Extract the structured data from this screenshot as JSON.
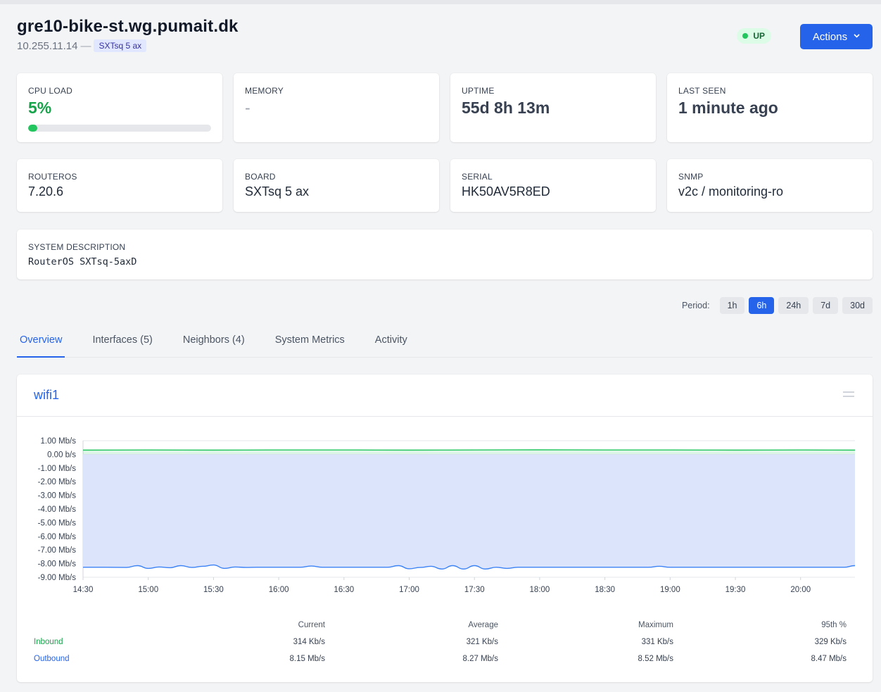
{
  "device": {
    "hostname": "gre10-bike-st.wg.pumait.dk",
    "ip": "10.255.11.14",
    "separator": "—",
    "model_badge": "SXTsq 5 ax",
    "status": "UP",
    "status_color": "#22c55e",
    "actions_label": "Actions"
  },
  "cards": {
    "cpu": {
      "label": "CPU LOAD",
      "value": "5%",
      "percent": 5
    },
    "memory": {
      "label": "MEMORY",
      "value": "-"
    },
    "uptime": {
      "label": "UPTIME",
      "value": "55d 8h 13m"
    },
    "last_seen": {
      "label": "LAST SEEN",
      "value": "1 minute ago"
    },
    "routeros": {
      "label": "ROUTEROS",
      "value": "7.20.6"
    },
    "board": {
      "label": "BOARD",
      "value": "SXTsq 5 ax"
    },
    "serial": {
      "label": "SERIAL",
      "value": "HK50AV5R8ED"
    },
    "snmp": {
      "label": "SNMP",
      "value": "v2c / monitoring-ro"
    },
    "sysdesc": {
      "label": "SYSTEM DESCRIPTION",
      "value": "RouterOS SXTsq-5axD"
    }
  },
  "period": {
    "label": "Period:",
    "options": [
      "1h",
      "6h",
      "24h",
      "7d",
      "30d"
    ],
    "selected": "6h"
  },
  "tabs": [
    "Overview",
    "Interfaces (5)",
    "Neighbors (4)",
    "System Metrics",
    "Activity"
  ],
  "active_tab": "Overview",
  "chart_card": {
    "title": "wifi1",
    "stats_headers": [
      "Current",
      "Average",
      "Maximum",
      "95th %"
    ],
    "rows": [
      {
        "name": "Inbound",
        "current": "314 Kb/s",
        "average": "321 Kb/s",
        "maximum": "331 Kb/s",
        "p95": "329 Kb/s"
      },
      {
        "name": "Outbound",
        "current": "8.15 Mb/s",
        "average": "8.27 Mb/s",
        "maximum": "8.52 Mb/s",
        "p95": "8.47 Mb/s"
      }
    ]
  },
  "chart_data": {
    "type": "area",
    "y_ticks": [
      "1.00 Mb/s",
      "0.00 b/s",
      "-1.00 Mb/s",
      "-2.00 Mb/s",
      "-3.00 Mb/s",
      "-4.00 Mb/s",
      "-5.00 Mb/s",
      "-6.00 Mb/s",
      "-7.00 Mb/s",
      "-8.00 Mb/s",
      "-9.00 Mb/s"
    ],
    "ylim": [
      -9.0,
      1.0
    ],
    "x_ticks": [
      "14:30",
      "15:00",
      "15:30",
      "16:00",
      "16:30",
      "17:00",
      "17:30",
      "18:00",
      "18:30",
      "19:00",
      "19:30",
      "20:00"
    ],
    "x_start_minutes": 870,
    "x_end_minutes": 1225,
    "grid": true,
    "series": [
      {
        "name": "Inbound",
        "color": "#22c55e",
        "x": [
          870,
          900,
          930,
          960,
          990,
          1020,
          1050,
          1080,
          1110,
          1140,
          1170,
          1200,
          1225
        ],
        "values": [
          0.31,
          0.32,
          0.31,
          0.32,
          0.32,
          0.31,
          0.32,
          0.33,
          0.32,
          0.32,
          0.31,
          0.32,
          0.31
        ]
      },
      {
        "name": "Outbound",
        "color": "#3b82f6",
        "fill": "#dbe4fb",
        "x": [
          870,
          880,
          890,
          895,
          900,
          905,
          910,
          915,
          920,
          925,
          930,
          935,
          940,
          945,
          950,
          960,
          970,
          975,
          980,
          985,
          990,
          1000,
          1010,
          1015,
          1020,
          1025,
          1030,
          1035,
          1040,
          1045,
          1050,
          1055,
          1060,
          1065,
          1070,
          1080,
          1085,
          1090,
          1100,
          1110,
          1120,
          1130,
          1135,
          1140,
          1145,
          1150,
          1155,
          1160,
          1170,
          1180,
          1190,
          1200,
          1210,
          1220,
          1225
        ],
        "values": [
          -8.27,
          -8.27,
          -8.28,
          -8.15,
          -8.35,
          -8.25,
          -8.3,
          -8.15,
          -8.28,
          -8.2,
          -8.1,
          -8.35,
          -8.25,
          -8.28,
          -8.27,
          -8.27,
          -8.27,
          -8.18,
          -8.27,
          -8.27,
          -8.27,
          -8.27,
          -8.27,
          -8.15,
          -8.38,
          -8.28,
          -8.2,
          -8.4,
          -8.15,
          -8.4,
          -8.15,
          -8.4,
          -8.27,
          -8.35,
          -8.27,
          -8.27,
          -8.27,
          -8.27,
          -8.27,
          -8.27,
          -8.27,
          -8.27,
          -8.2,
          -8.27,
          -8.27,
          -8.27,
          -8.27,
          -8.27,
          -8.27,
          -8.27,
          -8.27,
          -8.27,
          -8.27,
          -8.27,
          -8.15
        ]
      }
    ]
  }
}
